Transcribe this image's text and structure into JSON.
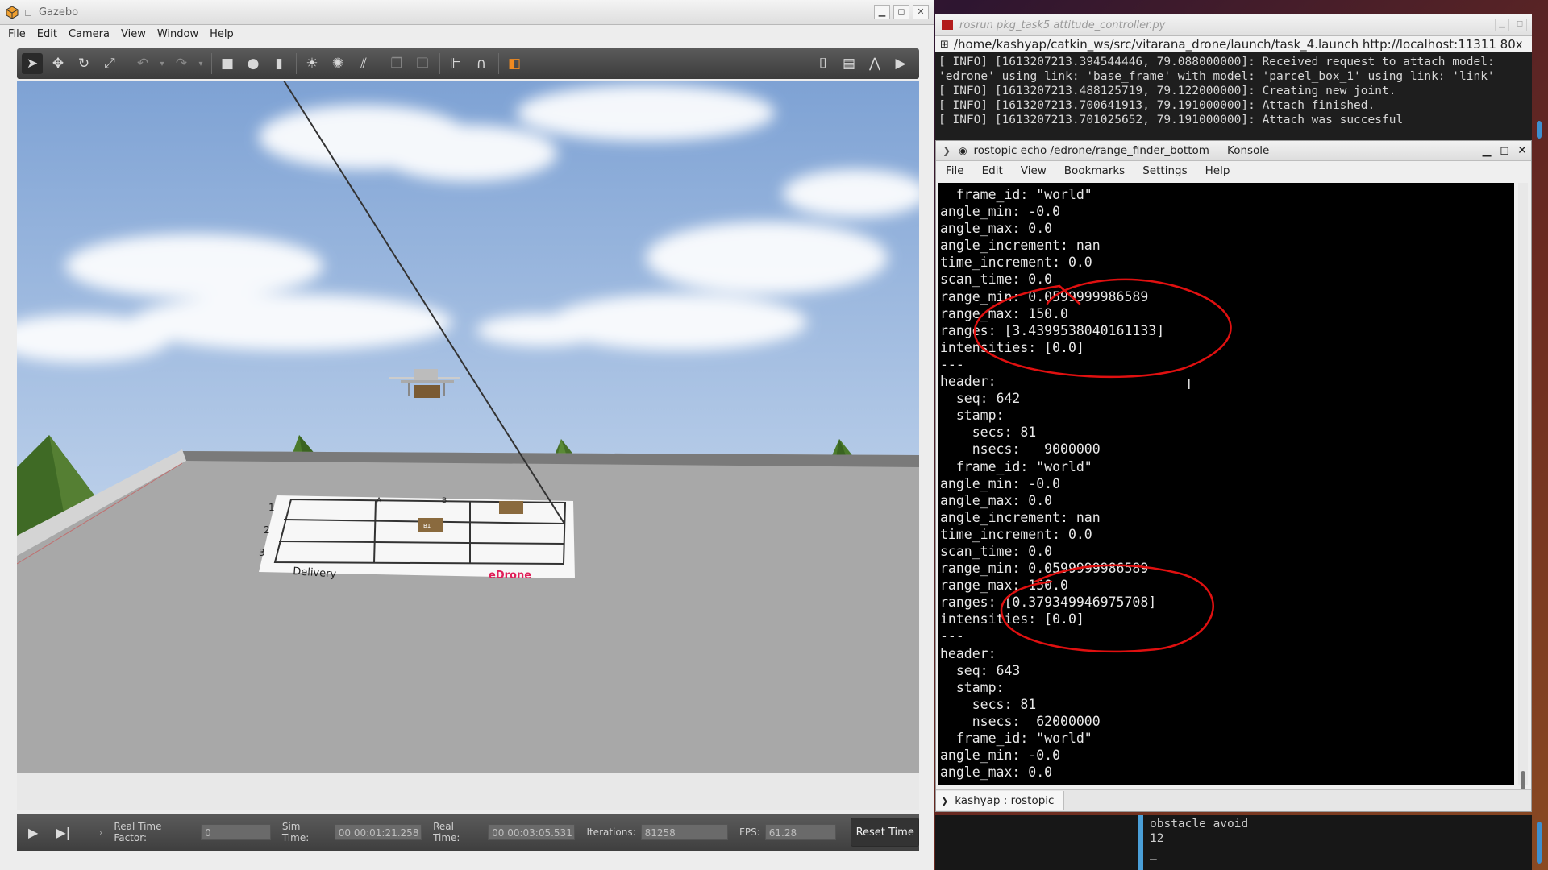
{
  "gazebo": {
    "title": "Gazebo",
    "menu": [
      "File",
      "Edit",
      "Camera",
      "View",
      "Window",
      "Help"
    ],
    "status": {
      "real_time_factor_label": "Real Time Factor:",
      "real_time_factor": "0",
      "sim_time_label": "Sim Time:",
      "sim_time": "00 00:01:21.258",
      "real_time_label": "Real Time:",
      "real_time": "00 00:03:05.531",
      "iterations_label": "Iterations:",
      "iterations": "81258",
      "fps_label": "FPS:",
      "fps": "61.28",
      "reset_label": "Reset Time"
    },
    "scene": {
      "mat_rows": [
        "1",
        "2",
        "3"
      ],
      "mat_cols": [
        "A",
        "B"
      ],
      "mat_label": "Delivery",
      "mat_brand": "eDrone",
      "box_label": "B1"
    }
  },
  "rosrun": {
    "title": "rosrun pkg_task5 attitude_controller.py",
    "url": "/home/kashyap/catkin_ws/src/vitarana_drone/launch/task_4.launch http://localhost:11311 80x",
    "log": [
      "[ INFO] [1613207213.394544446, 79.088000000]: Received request to attach model:",
      "'edrone' using link: 'base_frame' with model: 'parcel_box_1' using link: 'link'",
      "[ INFO] [1613207213.488125719, 79.122000000]: Creating new joint.",
      "[ INFO] [1613207213.700641913, 79.191000000]: Attach finished.",
      "[ INFO] [1613207213.701025652, 79.191000000]: Attach was succesful"
    ]
  },
  "konsole": {
    "title": "rostopic echo /edrone/range_finder_bottom — Konsole",
    "menu": [
      "File",
      "Edit",
      "View",
      "Bookmarks",
      "Settings",
      "Help"
    ],
    "tab_label": "kashyap : rostopic",
    "lines": [
      "  frame_id: \"world\"",
      "angle_min: -0.0",
      "angle_max: 0.0",
      "angle_increment: nan",
      "time_increment: 0.0",
      "scan_time: 0.0",
      "range_min: 0.0599999986589",
      "range_max: 150.0",
      "ranges: [3.4399538040161133]",
      "intensities: [0.0]",
      "---",
      "header:",
      "  seq: 642",
      "  stamp:",
      "    secs: 81",
      "    nsecs:   9000000",
      "  frame_id: \"world\"",
      "angle_min: -0.0",
      "angle_max: 0.0",
      "angle_increment: nan",
      "time_increment: 0.0",
      "scan_time: 0.0",
      "range_min: 0.0599999986589",
      "range_max: 150.0",
      "ranges: [0.379349946975708]",
      "intensities: [0.0]",
      "---",
      "header:",
      "  seq: 643",
      "  stamp:",
      "    secs: 81",
      "    nsecs:  62000000",
      "  frame_id: \"world\"",
      "angle_min: -0.0",
      "angle_max: 0.0"
    ]
  },
  "bottom_terminal": {
    "lines": [
      "obstacle avoid",
      "12",
      "_"
    ]
  },
  "colors": {
    "annotation": "#e01010",
    "sky": "#a9c2e2",
    "tree": "#3f6a25",
    "roof": "#a8a8a8"
  }
}
